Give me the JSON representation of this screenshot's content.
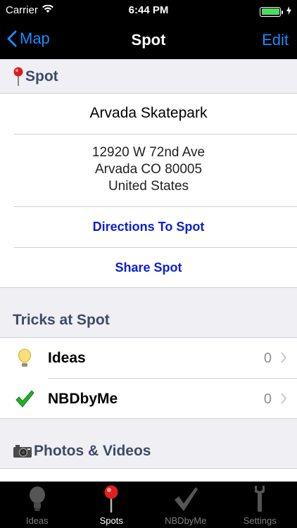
{
  "status_bar": {
    "carrier": "Carrier",
    "time": "6:44 PM",
    "battery_level": 1.0
  },
  "nav": {
    "back_label": "Map",
    "title": "Spot",
    "edit_label": "Edit"
  },
  "spot_section": {
    "header": "Spot",
    "name": "Arvada Skatepark",
    "address_lines": [
      "12920 W 72nd Ave",
      "Arvada CO 80005",
      "United States"
    ],
    "directions_label": "Directions To Spot",
    "share_label": "Share Spot"
  },
  "tricks_section": {
    "header": "Tricks at Spot",
    "items": [
      {
        "label": "Ideas",
        "count": "0",
        "icon": "lightbulb-icon"
      },
      {
        "label": "NBDbyMe",
        "count": "0",
        "icon": "checkmark-icon"
      }
    ]
  },
  "media_section": {
    "header": "Photos & Videos"
  },
  "tab_bar": {
    "tabs": [
      {
        "label": "Ideas",
        "icon": "lightbulb-icon",
        "active": false
      },
      {
        "label": "Spots",
        "icon": "pin-icon",
        "active": true
      },
      {
        "label": "NBDbyMe",
        "icon": "checkmark-icon",
        "active": false
      },
      {
        "label": "Settings",
        "icon": "wrench-icon",
        "active": false
      }
    ]
  },
  "colors": {
    "accent": "#1a8cff",
    "link": "#0a1fd6",
    "section_header": "#3e4a66",
    "battery": "#4cd964"
  }
}
